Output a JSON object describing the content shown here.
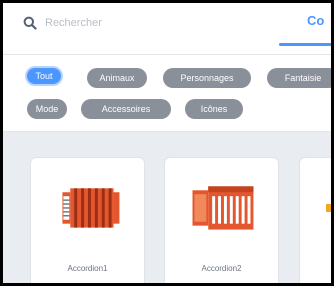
{
  "search": {
    "placeholder": "Rechercher"
  },
  "tabs": {
    "active_label": "Co"
  },
  "filters": [
    {
      "label": "Tout",
      "active": true
    },
    {
      "label": "Animaux",
      "active": false
    },
    {
      "label": "Personnages",
      "active": false
    },
    {
      "label": "Fantaisie",
      "active": false
    },
    {
      "label": "Mode",
      "active": false
    },
    {
      "label": "Accessoires",
      "active": false
    },
    {
      "label": "Icônes",
      "active": false
    }
  ],
  "items": [
    {
      "name": "Accordion1",
      "icon": "accordion-icon",
      "color": "#e4572e"
    },
    {
      "name": "Accordion2",
      "icon": "accordion-icon",
      "color": "#e4572e"
    }
  ],
  "colors": {
    "accent": "#4c97ff",
    "chip": "#8a9099",
    "gallery_bg": "#e9ecf1"
  }
}
